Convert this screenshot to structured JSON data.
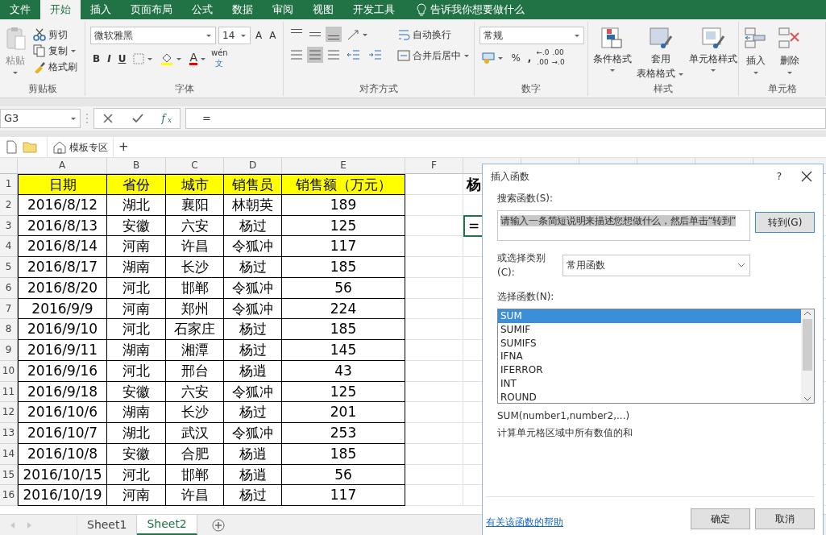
{
  "menu_tabs": [
    {
      "label": "文件",
      "selected": false
    },
    {
      "label": "开始",
      "selected": true
    },
    {
      "label": "插入",
      "selected": false
    },
    {
      "label": "页面布局",
      "selected": false
    },
    {
      "label": "公式",
      "selected": false
    },
    {
      "label": "数据",
      "selected": false
    },
    {
      "label": "审阅",
      "selected": false
    },
    {
      "label": "视图",
      "selected": false
    },
    {
      "label": "开发工具",
      "selected": false
    }
  ],
  "tell_me": "告诉我你想要做什么",
  "clipboard": {
    "paste": "粘贴",
    "cut": "剪切",
    "copy": "复制",
    "format_painter": "格式刷",
    "label": "剪贴板"
  },
  "font": {
    "name": "微软雅黑",
    "size": "14",
    "grow": "A",
    "shrink": "A",
    "styles": [
      "B",
      "I",
      "U"
    ],
    "color_letter": "A",
    "phonetic": [
      "wén",
      "文"
    ],
    "label": "字体"
  },
  "alignment": {
    "vertical": [
      {
        "selected": false
      },
      {
        "selected": false
      },
      {
        "selected": true
      }
    ],
    "horizontal": [
      {
        "selected": false
      },
      {
        "selected": true
      },
      {
        "selected": false
      }
    ],
    "wrap": "自动换行",
    "merge": "合并后居中",
    "label": "对齐方式"
  },
  "number": {
    "format": "常规",
    "percent": "%",
    "comma": ",",
    "decimals": [
      {
        "lines": [
          "←.0",
          ".00"
        ]
      },
      {
        "lines": [
          ".00",
          "→.0"
        ]
      }
    ],
    "label": "数字"
  },
  "styles": {
    "buttons": [
      {
        "lines": [
          "条件格式"
        ]
      },
      {
        "lines": [
          "套用",
          "表格格式"
        ]
      },
      {
        "lines": [
          "单元格样式"
        ]
      }
    ],
    "label": "样式"
  },
  "cells": {
    "buttons": [
      {
        "lines": [
          "插入"
        ]
      },
      {
        "lines": [
          "删除"
        ]
      }
    ],
    "label": "单元格"
  },
  "formula_bar": {
    "name_box": "G3",
    "fx": "f$_{x}$",
    "formula": "="
  },
  "quick_bar": {
    "template": "模板专区",
    "add": "+"
  },
  "sheet": {
    "columns": [
      "A",
      "B",
      "C",
      "D",
      "E",
      "F"
    ],
    "header": [
      "日期",
      "省份",
      "城市",
      "销售员",
      "销售额（万元）"
    ],
    "rows": [
      [
        "2016/8/12",
        "湖北",
        "襄阳",
        "林朝英",
        "189"
      ],
      [
        "2016/8/13",
        "安徽",
        "六安",
        "杨过",
        "125"
      ],
      [
        "2016/8/14",
        "河南",
        "许昌",
        "令狐冲",
        "117"
      ],
      [
        "2016/8/17",
        "湖南",
        "长沙",
        "杨过",
        "185"
      ],
      [
        "2016/8/20",
        "河北",
        "邯郸",
        "令狐冲",
        "56"
      ],
      [
        "2016/9/9",
        "河南",
        "郑州",
        "令狐冲",
        "224"
      ],
      [
        "2016/9/10",
        "河北",
        "石家庄",
        "杨过",
        "185"
      ],
      [
        "2016/9/11",
        "湖南",
        "湘潭",
        "杨过",
        "145"
      ],
      [
        "2016/9/16",
        "河北",
        "邢台",
        "杨逍",
        "43"
      ],
      [
        "2016/9/18",
        "安徽",
        "六安",
        "令狐冲",
        "125"
      ],
      [
        "2016/10/6",
        "湖南",
        "长沙",
        "杨过",
        "201"
      ],
      [
        "2016/10/7",
        "湖北",
        "武汉",
        "令狐冲",
        "253"
      ],
      [
        "2016/10/8",
        "安徽",
        "合肥",
        "杨逍",
        "185"
      ],
      [
        "2016/10/15",
        "河北",
        "邯郸",
        "杨逍",
        "56"
      ],
      [
        "2016/10/19",
        "河南",
        "许昌",
        "杨过",
        "117"
      ]
    ],
    "row_numbers": [
      "1",
      "2",
      "3",
      "4",
      "5",
      "6",
      "7",
      "8",
      "9",
      "10",
      "11",
      "12",
      "13",
      "14",
      "15",
      "16"
    ],
    "title": "杨",
    "active_cell": "="
  },
  "sheet_tabs": [
    {
      "label": "Sheet1",
      "selected": false
    },
    {
      "label": "Sheet2",
      "selected": true
    }
  ],
  "dialog": {
    "title": "插入函数",
    "help": "?",
    "search_label": "搜索函数(S):",
    "search_value": "请输入一条简短说明来描述您想做什么，然后单击“转到”",
    "go": "转到(G)",
    "category_label": "或选择类别(C):",
    "category": "常用函数",
    "list_label": "选择函数(N):",
    "functions": [
      {
        "name": "SUM",
        "selected": true
      },
      {
        "name": "SUMIF",
        "selected": false
      },
      {
        "name": "SUMIFS",
        "selected": false
      },
      {
        "name": "IFNA",
        "selected": false
      },
      {
        "name": "IFERROR",
        "selected": false
      },
      {
        "name": "INT",
        "selected": false
      },
      {
        "name": "ROUND",
        "selected": false
      }
    ],
    "signature": "SUM(number1,number2,...)",
    "description": "计算单元格区域中所有数值的和",
    "help_link": "有关该函数的帮助",
    "ok": "确定",
    "cancel": "取消"
  }
}
